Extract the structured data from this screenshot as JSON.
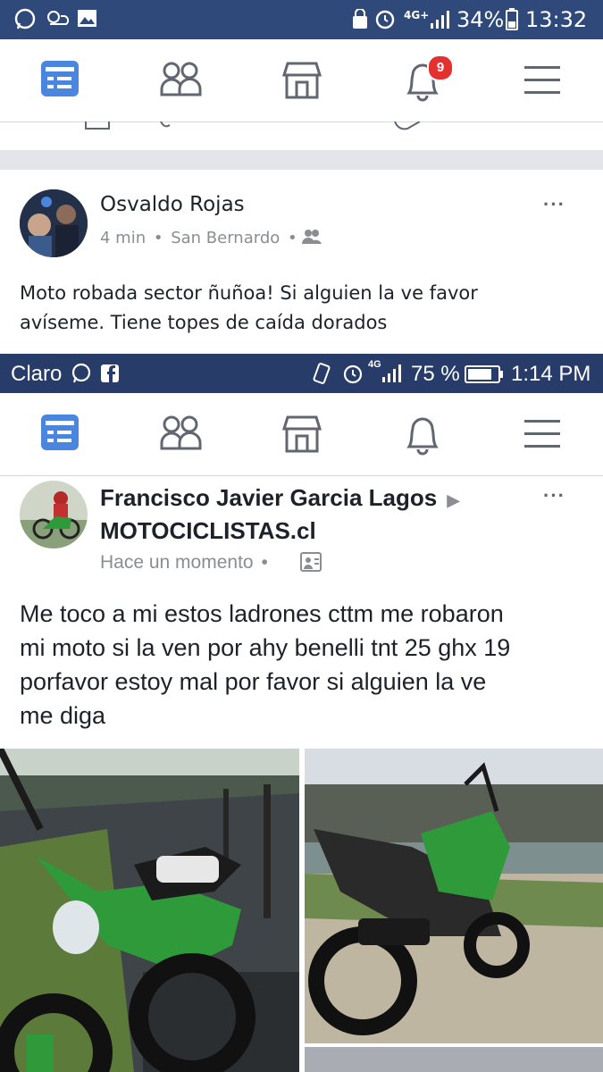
{
  "status_bar_top": {
    "battery": "34%",
    "time": "13:32",
    "network": "4G+"
  },
  "nav_top": {
    "notifications_badge": "9"
  },
  "post1": {
    "author": "Osvaldo Rojas",
    "time": "4 min",
    "location": "San Bernardo",
    "more": "···",
    "text_line1": "Moto robada sector ñuñoa! Si alguien la ve favor",
    "text_line2": "avíseme. Tiene topes de caída dorados"
  },
  "status_bar_embedded": {
    "carrier": "Claro",
    "battery": "75 %",
    "time": "1:14 PM",
    "network": "4G"
  },
  "post2": {
    "author": "Francisco Javier Garcia Lagos",
    "group": "MOTOCICLISTAS.cl",
    "time": "Hace un momento",
    "more": "···",
    "text_line1": "Me toco a mi estos ladrones cttm me robaron",
    "text_line2": "mi moto si la ven por ahy benelli tnt 25 ghx 19",
    "text_line3": "porfavor estoy mal por favor si alguien la ve",
    "text_line4": "me diga"
  },
  "colors": {
    "status_bar": "#2f4a7a",
    "accent": "#4a86e0",
    "badge": "#e4312f",
    "moto_green": "#2f9a3a"
  }
}
